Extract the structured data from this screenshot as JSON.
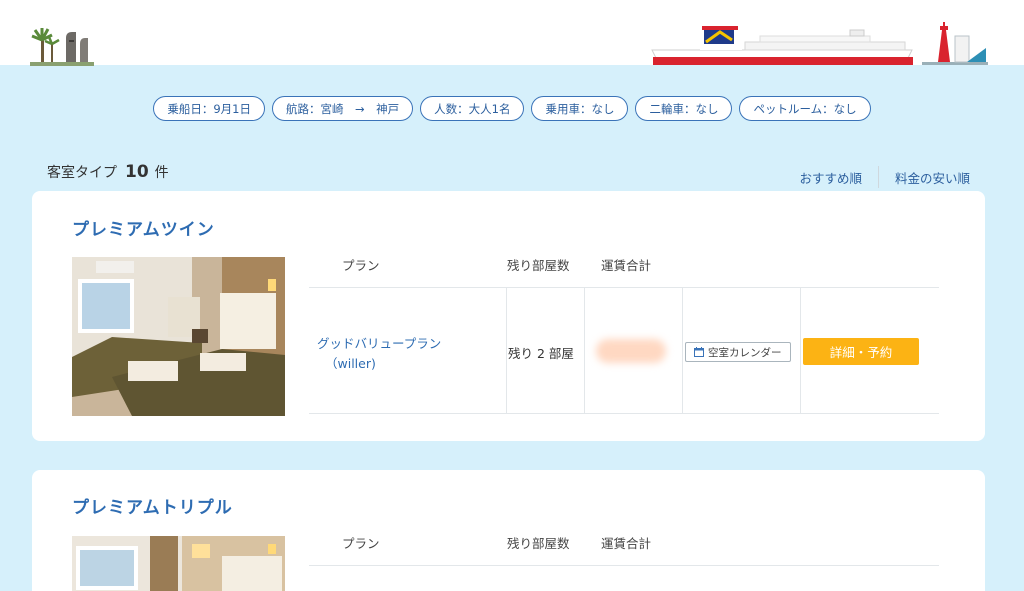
{
  "filters": [
    {
      "id": "date",
      "label": "乗船日：9月1日"
    },
    {
      "id": "route",
      "label": "航路：宮崎　→　神戸"
    },
    {
      "id": "people",
      "label": "人数：大人1名"
    },
    {
      "id": "car",
      "label": "乗用車：なし"
    },
    {
      "id": "bike",
      "label": "二輪車：なし"
    },
    {
      "id": "pet",
      "label": "ペットルーム：なし"
    }
  ],
  "results": {
    "label": "客室タイプ",
    "count": "10",
    "unit": "件"
  },
  "sort": {
    "recommended": "おすすめ順",
    "cheapest": "料金の安い順"
  },
  "table_headers": {
    "plan": "プラン",
    "rooms": "残り部屋数",
    "fare": "運賃合計"
  },
  "rooms": [
    {
      "title": "プレミアムツイン",
      "plan_name": "グッドバリュープラン",
      "plan_sub": "（willer)",
      "rooms_left": "残り 2 部屋",
      "calendar_label": "空室カレンダー",
      "reserve_label": "詳細・予約"
    },
    {
      "title": "プレミアムトリプル"
    }
  ],
  "colors": {
    "accent": "#2e6cb2",
    "button": "#fcb314",
    "background": "#d6f0fb"
  }
}
